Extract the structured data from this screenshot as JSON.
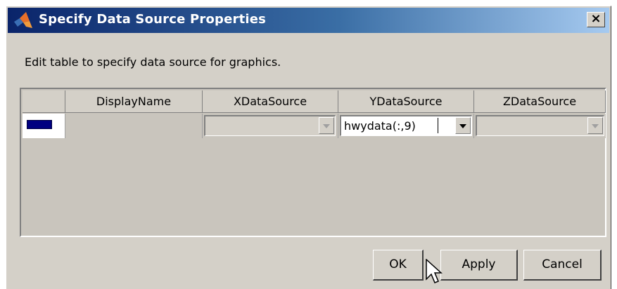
{
  "window": {
    "title": "Specify Data Source Properties",
    "close_label": "×"
  },
  "instructions": "Edit table to specify data source for graphics.",
  "table": {
    "columns": [
      "",
      "DisplayName",
      "XDataSource",
      "YDataSource",
      "ZDataSource"
    ],
    "rows": [
      {
        "color": "#000080",
        "display_name": "",
        "x_data_source": "",
        "y_data_source": "hwydata(:,9)",
        "z_data_source": ""
      }
    ]
  },
  "buttons": {
    "ok": "OK",
    "apply": "Apply",
    "cancel": "Cancel"
  },
  "icons": {
    "title": "matlab-logo-icon",
    "close": "close-icon",
    "dropdown": "chevron-down-icon",
    "pointer": "mouse-pointer-icon"
  }
}
